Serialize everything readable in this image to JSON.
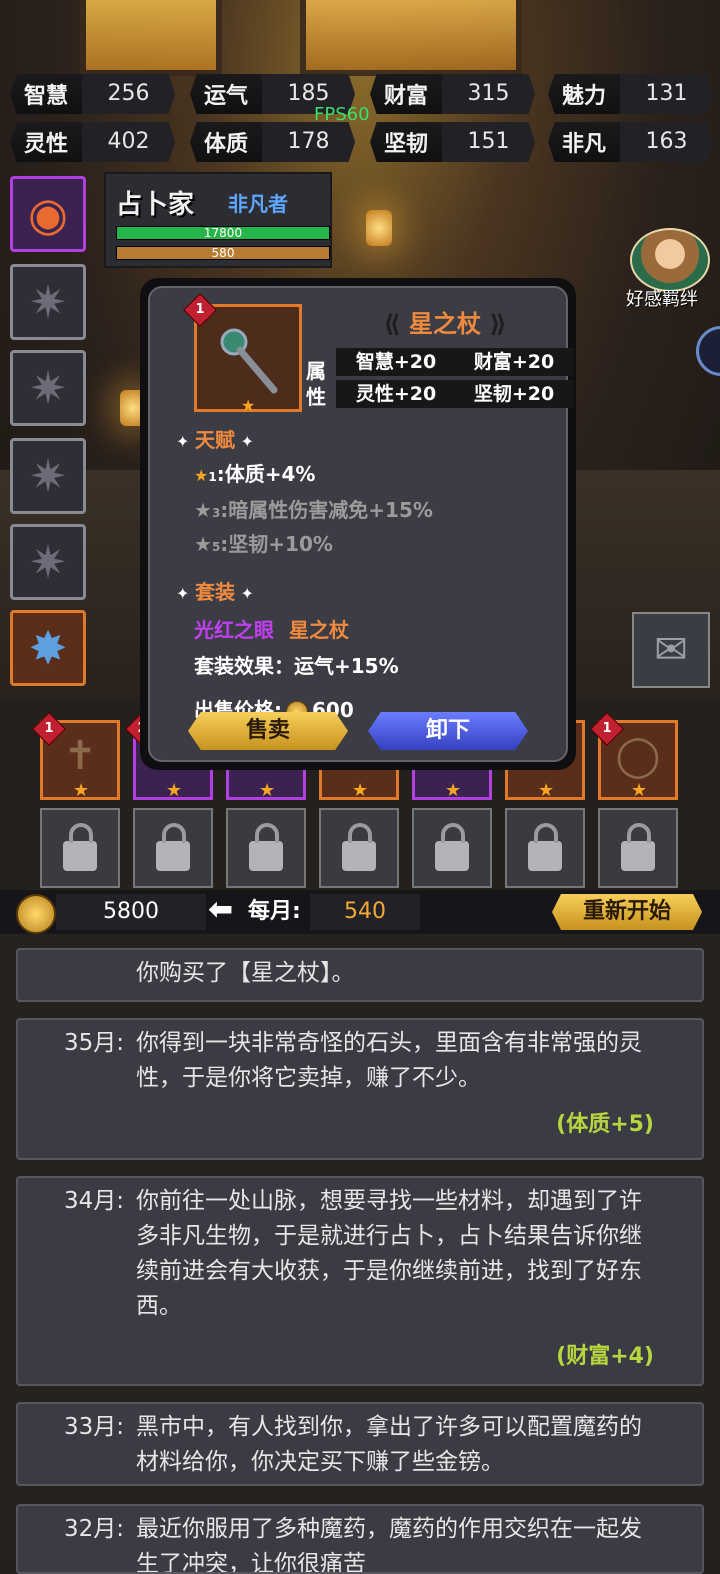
{
  "stats": [
    {
      "name": "智慧",
      "value": "256"
    },
    {
      "name": "运气",
      "value": "185"
    },
    {
      "name": "财富",
      "value": "315"
    },
    {
      "name": "魅力",
      "value": "131"
    },
    {
      "name": "灵性",
      "value": "402"
    },
    {
      "name": "体质",
      "value": "178"
    },
    {
      "name": "坚韧",
      "value": "151"
    },
    {
      "name": "非凡",
      "value": "163"
    }
  ],
  "fps": "FPS60",
  "character": {
    "name": "占卜家",
    "title": "非凡者",
    "hp": "17800",
    "mp": "580"
  },
  "companion": {
    "label": "好感羁绊"
  },
  "item": {
    "level": "1",
    "name": "星之杖",
    "attr_label": "属性",
    "attributes": [
      "智慧+20",
      "财富+20",
      "灵性+20",
      "坚韧+20"
    ],
    "talent_title": "天赋",
    "talents": [
      {
        "idx": "1",
        "text": ":体质+4%",
        "active": true
      },
      {
        "idx": "3",
        "text": ":暗属性伤害减免+15%",
        "active": false
      },
      {
        "idx": "5",
        "text": ":坚韧+10%",
        "active": false
      }
    ],
    "set_title": "套装",
    "set_names": [
      "光红之眼",
      "星之杖"
    ],
    "set_effect": "套装效果：运气+15%",
    "price_label": "出售价格:",
    "price": "600",
    "sell_label": "售卖",
    "unequip_label": "卸下"
  },
  "equip_badges": [
    "1",
    "2",
    "1"
  ],
  "money": {
    "gold": "5800",
    "monthly_label": "每月:",
    "monthly": "540",
    "restart_label": "重新开始"
  },
  "log": [
    {
      "month": "",
      "text": "你购买了【星之杖】。",
      "reward": ""
    },
    {
      "month": "35月:",
      "text": "你得到一块非常奇怪的石头，里面含有非常强的灵性，于是你将它卖掉，赚了不少。",
      "reward": "(体质+5)"
    },
    {
      "month": "34月:",
      "text": "你前往一处山脉，想要寻找一些材料，却遇到了许多非凡生物，于是就进行占卜，占卜结果告诉你继续前进会有大收获，于是你继续前进，找到了好东西。",
      "reward": "(财富+4)"
    },
    {
      "month": "33月:",
      "text": "黑市中，有人找到你，拿出了许多可以配置魔药的材料给你，你决定买下赚了些金镑。",
      "reward": ""
    },
    {
      "month": "32月:",
      "text": "最近你服用了多种魔药，魔药的作用交织在一起发生了冲突，让你很痛苦",
      "reward": ""
    }
  ],
  "colors": {
    "orange": "#f08a3e",
    "purple": "#b040e0",
    "green": "#b8d640",
    "blue": "#5ea6ff"
  }
}
